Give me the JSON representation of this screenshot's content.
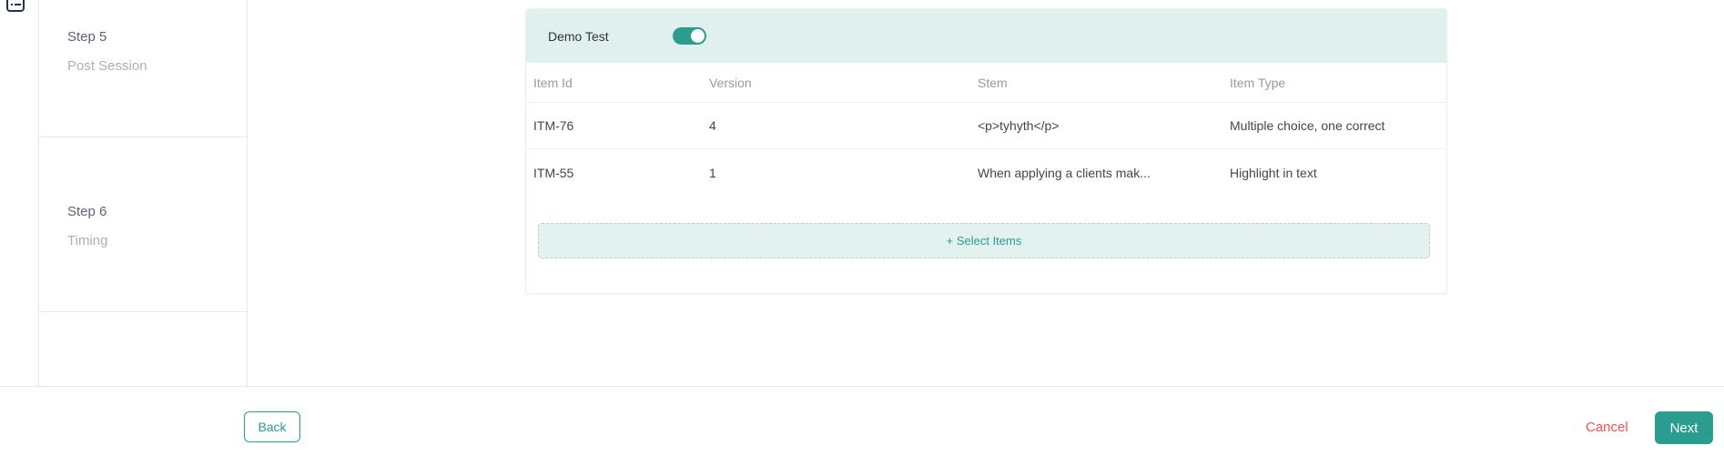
{
  "sidebar": {
    "steps": [
      {
        "step": "Step 5",
        "label": "Post Session"
      },
      {
        "step": "Step 6",
        "label": "Timing"
      }
    ]
  },
  "card": {
    "title": "Demo Test",
    "toggle": {
      "state": "on"
    },
    "table": {
      "columns": [
        "Item Id",
        "Version",
        "Stem",
        "Item Type"
      ],
      "rows": [
        {
          "item_id": "ITM-76",
          "version": "4",
          "stem": "<p>tyhyth</p>",
          "item_type": "Multiple choice, one correct"
        },
        {
          "item_id": "ITM-55",
          "version": "1",
          "stem": "When applying a clients mak...",
          "item_type": "Highlight in text"
        }
      ]
    },
    "select_items_label": "+ Select Items"
  },
  "footer": {
    "back_label": "Back",
    "cancel_label": "Cancel",
    "next_label": "Next"
  },
  "icons": {
    "top_left": "list-icon"
  },
  "colors": {
    "accent_teal": "#2a9d8f",
    "card_header_bg": "#dff0ee",
    "select_items_bg": "#e3f1ef",
    "cancel_red": "#f4524d",
    "border_gray": "#e3e7ee",
    "muted_text": "#939aa5"
  }
}
